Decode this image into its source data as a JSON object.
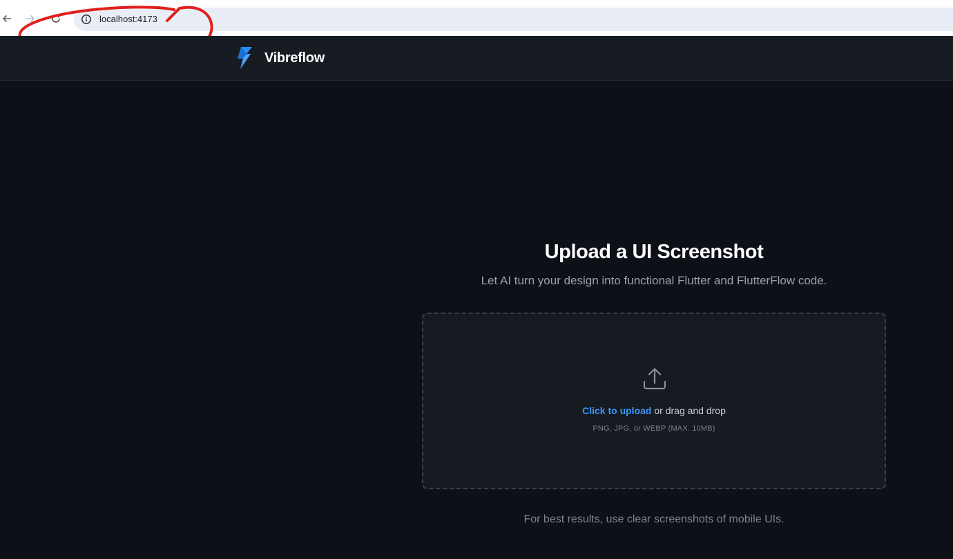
{
  "browser": {
    "url": "localhost:4173",
    "icons": {
      "back": "arrow-left-icon",
      "forward": "arrow-right-icon",
      "reload": "reload-icon",
      "site_info": "info-circle-icon"
    },
    "annotation_color": "#e0201b"
  },
  "header": {
    "brand_name": "Vibreflow",
    "logo_icon": "vibreflow-logo-icon",
    "logo_color": "#2b8cf7"
  },
  "main": {
    "title": "Upload a UI Screenshot",
    "subtitle": "Let AI turn your design into functional Flutter and FlutterFlow code.",
    "dropzone": {
      "icon": "upload-icon",
      "link_text": "Click to upload",
      "suffix_text": " or drag and drop",
      "hint": "PNG, JPG, or WEBP (MAX. 10MB)"
    },
    "footer_tip": "For best results, use clear screenshots of mobile UIs."
  },
  "colors": {
    "background": "#0d1017",
    "header_bg": "#171b22",
    "accent": "#3b97f6"
  }
}
